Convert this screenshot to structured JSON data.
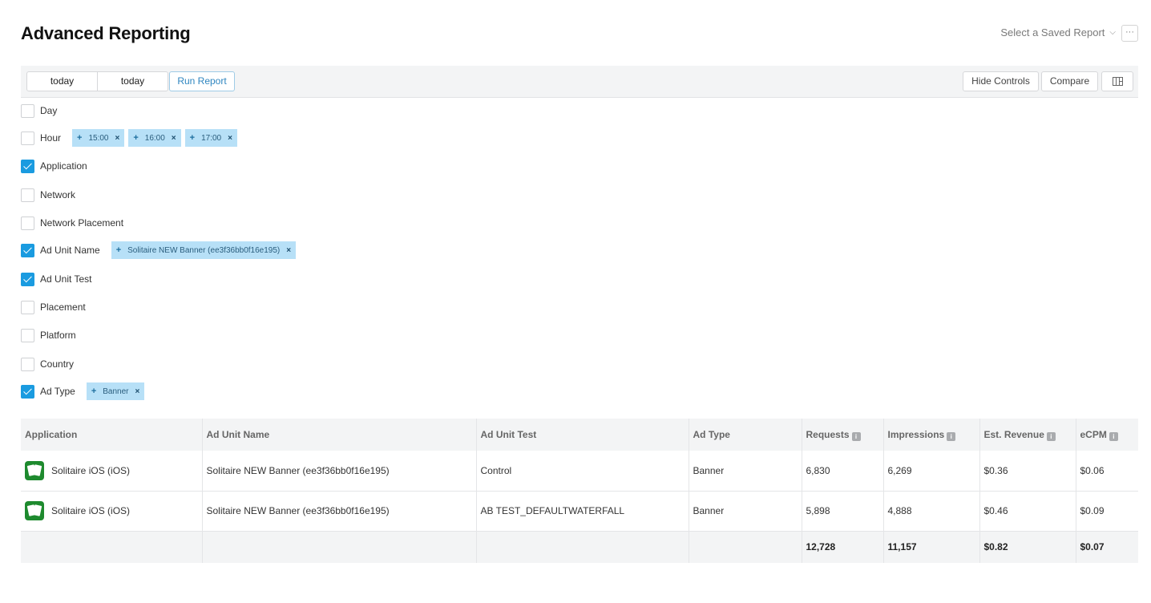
{
  "header": {
    "title": "Advanced Reporting",
    "saved_report_label": "Select a Saved Report",
    "more_label": "···"
  },
  "toolbar": {
    "date_from": "today",
    "date_to": "today",
    "run_label": "Run Report",
    "hide_controls_label": "Hide Controls",
    "compare_label": "Compare"
  },
  "dimensions": [
    {
      "label": "Day",
      "checked": false,
      "chips": []
    },
    {
      "label": "Hour",
      "checked": false,
      "chips": [
        "15:00",
        "16:00",
        "17:00"
      ]
    },
    {
      "label": "Application",
      "checked": true,
      "chips": []
    },
    {
      "label": "Network",
      "checked": false,
      "chips": []
    },
    {
      "label": "Network Placement",
      "checked": false,
      "chips": []
    },
    {
      "label": "Ad Unit Name",
      "checked": true,
      "chips": [
        "Solitaire NEW Banner (ee3f36bb0f16e195)"
      ]
    },
    {
      "label": "Ad Unit Test",
      "checked": true,
      "chips": []
    },
    {
      "label": "Placement",
      "checked": false,
      "chips": []
    },
    {
      "label": "Platform",
      "checked": false,
      "chips": []
    },
    {
      "label": "Country",
      "checked": false,
      "chips": []
    },
    {
      "label": "Ad Type",
      "checked": true,
      "chips": [
        "Banner"
      ]
    }
  ],
  "table": {
    "columns": [
      "Application",
      "Ad Unit Name",
      "Ad Unit Test",
      "Ad Type",
      "Requests",
      "Impressions",
      "Est. Revenue",
      "eCPM"
    ],
    "rows": [
      [
        "Solitaire iOS (iOS)",
        "Solitaire NEW Banner (ee3f36bb0f16e195)",
        "Control",
        "Banner",
        "6,830",
        "6,269",
        "$0.36",
        "$0.06"
      ],
      [
        "Solitaire iOS (iOS)",
        "Solitaire NEW Banner (ee3f36bb0f16e195)",
        "AB TEST_DEFAULTWATERFALL",
        "Banner",
        "5,898",
        "4,888",
        "$0.46",
        "$0.09"
      ]
    ],
    "totals": [
      "",
      "",
      "",
      "",
      "12,728",
      "11,157",
      "$0.82",
      "$0.07"
    ]
  }
}
